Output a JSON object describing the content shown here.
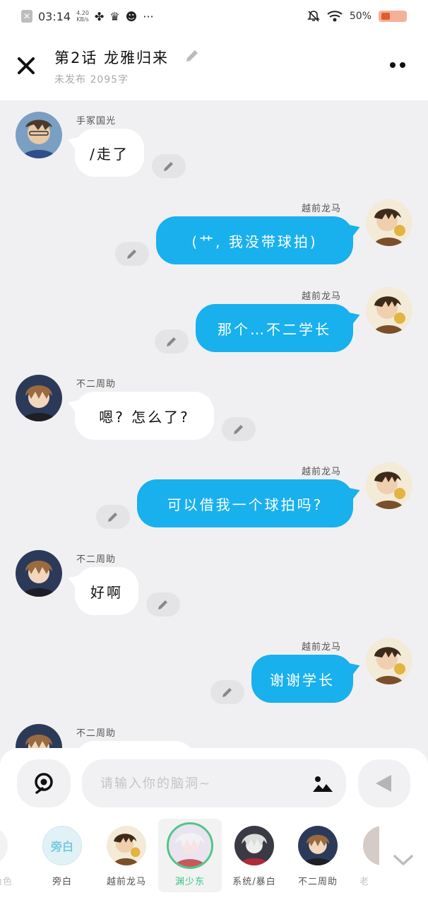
{
  "status_bar": {
    "time": "03:14",
    "net_speed_top": "4.20",
    "net_speed_bottom": "KB/s",
    "more": "···",
    "battery_percent": "50%"
  },
  "header": {
    "title": "第2话  龙雅归来",
    "subtitle": "未发布  2095字"
  },
  "messages": [
    {
      "side": "left",
      "name": "手冢国光",
      "text": "/走了",
      "avatar_color": "#5a7fa0"
    },
    {
      "side": "right",
      "name": "越前龙马",
      "text": "(艹, 我没带球拍)",
      "avatar_color": "#8a5a34"
    },
    {
      "side": "right",
      "name": "越前龙马",
      "text": "那个…不二学长",
      "avatar_color": "#8a5a34"
    },
    {
      "side": "left",
      "name": "不二周助",
      "text": "嗯? 怎么了?",
      "avatar_color": "#3b4a66"
    },
    {
      "side": "right",
      "name": "越前龙马",
      "text": "可以借我一个球拍吗?",
      "avatar_color": "#8a5a34"
    },
    {
      "side": "left",
      "name": "不二周助",
      "text": "好啊",
      "avatar_color": "#3b4a66"
    },
    {
      "side": "right",
      "name": "越前龙马",
      "text": "谢谢学长",
      "avatar_color": "#8a5a34"
    },
    {
      "side": "left",
      "name": "不二周助",
      "text": "",
      "avatar_color": "#3b4a66"
    }
  ],
  "input": {
    "placeholder": "请输入你的脑洞~"
  },
  "roles": [
    {
      "name": "角色",
      "kind": "partial-left"
    },
    {
      "name": "旁白",
      "kind": "narration",
      "badge": "旁白"
    },
    {
      "name": "越前龙马",
      "kind": "avatar"
    },
    {
      "name": "渊少东",
      "kind": "avatar",
      "selected": true
    },
    {
      "name": "系统/暴白",
      "kind": "avatar"
    },
    {
      "name": "不二周助",
      "kind": "avatar"
    },
    {
      "name": "老",
      "kind": "partial-right"
    }
  ],
  "colors": {
    "bubble_right": "#19b0ee",
    "bubble_left": "#ffffff",
    "selected_role": "#36c68a"
  }
}
